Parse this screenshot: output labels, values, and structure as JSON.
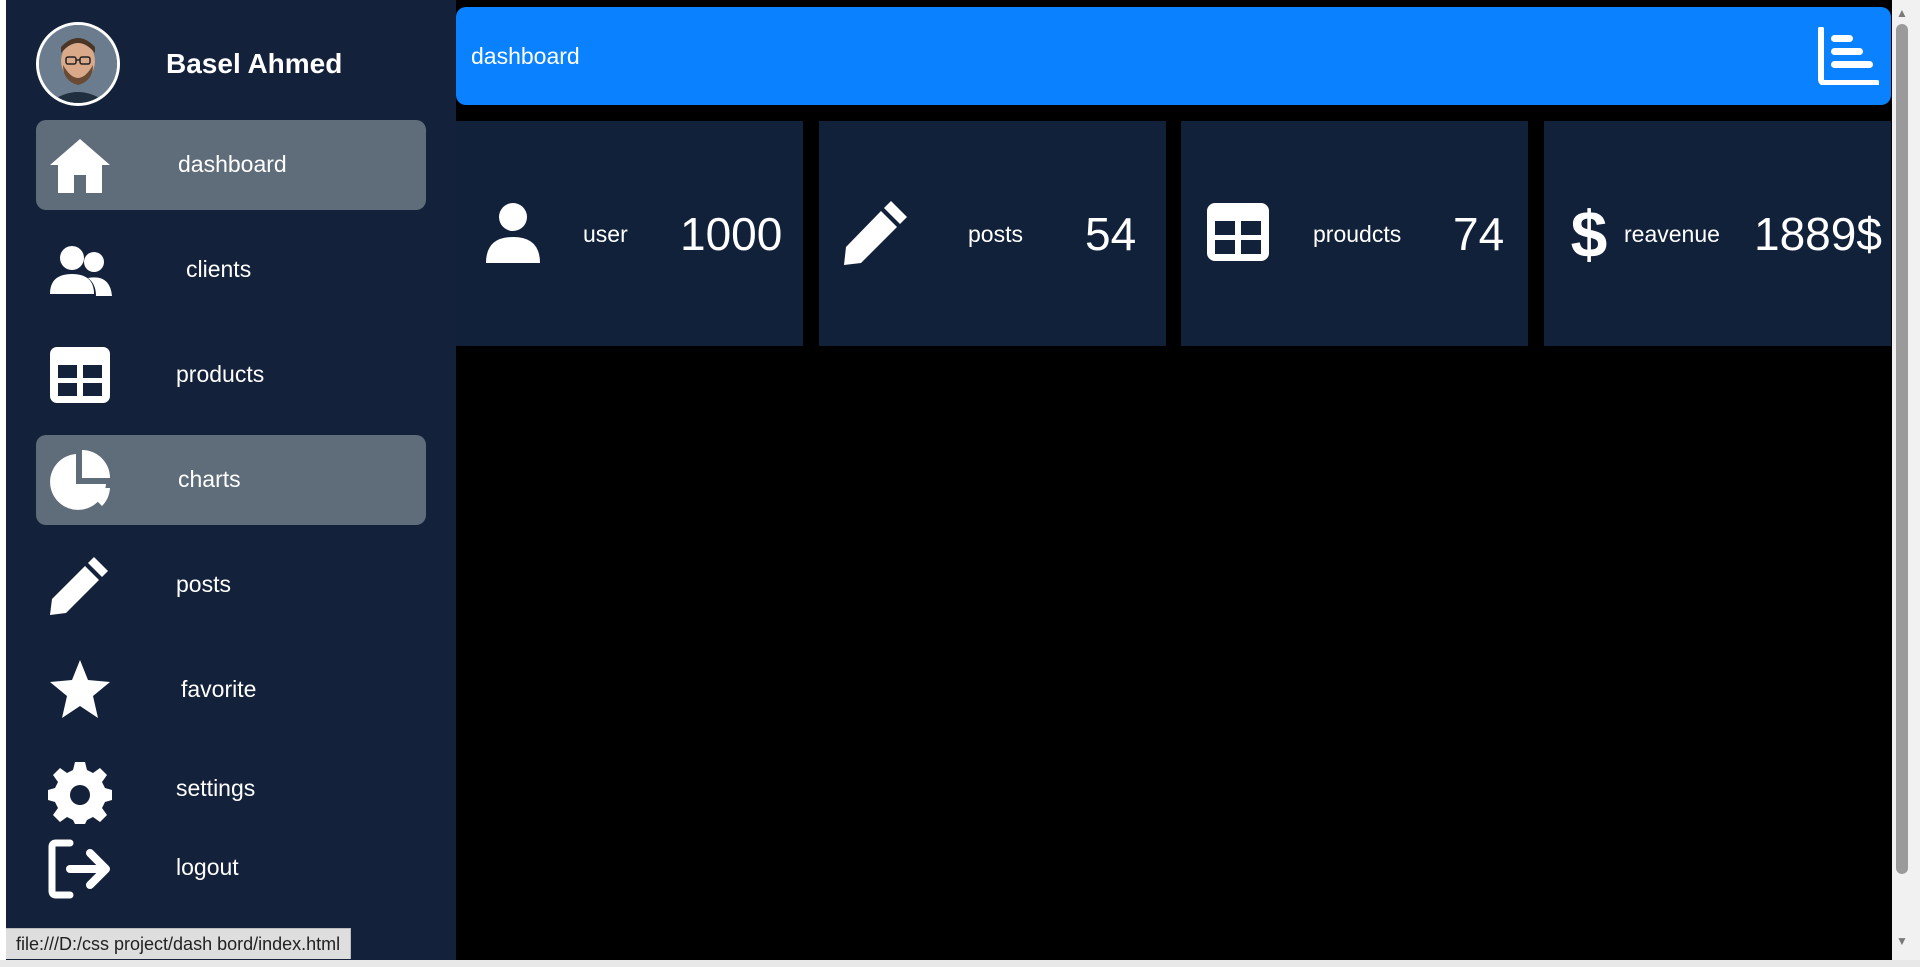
{
  "profile": {
    "name": "Basel Ahmed"
  },
  "sidebar": {
    "items": [
      {
        "label": "dashboard",
        "icon": "home-icon",
        "active": true
      },
      {
        "label": "clients",
        "icon": "users-icon",
        "active": false
      },
      {
        "label": "products",
        "icon": "table-icon",
        "active": false
      },
      {
        "label": "charts",
        "icon": "pie-chart-icon",
        "active": true
      },
      {
        "label": "posts",
        "icon": "pencil-icon",
        "active": false
      },
      {
        "label": "favorite",
        "icon": "star-icon",
        "active": false
      },
      {
        "label": "settings",
        "icon": "gear-icon",
        "active": false
      },
      {
        "label": "logout",
        "icon": "logout-icon",
        "active": false
      }
    ]
  },
  "header": {
    "title": "dashboard",
    "icon": "bar-chart-icon"
  },
  "cards": [
    {
      "label": "user",
      "value": "1000",
      "icon": "user-icon"
    },
    {
      "label": "posts",
      "value": "54",
      "icon": "pencil-icon"
    },
    {
      "label": "proudcts",
      "value": "74",
      "icon": "table-icon"
    },
    {
      "label": "reavenue",
      "value": "1889$",
      "icon": "dollar-icon"
    }
  ],
  "status_url": "file:///D:/css project/dash bord/index.html",
  "colors": {
    "sidebar_bg": "#13213a",
    "active_item_bg": "#5f6c79",
    "header_bg": "#0a82ff",
    "card_bg": "#12213a",
    "main_bg": "#000000"
  }
}
